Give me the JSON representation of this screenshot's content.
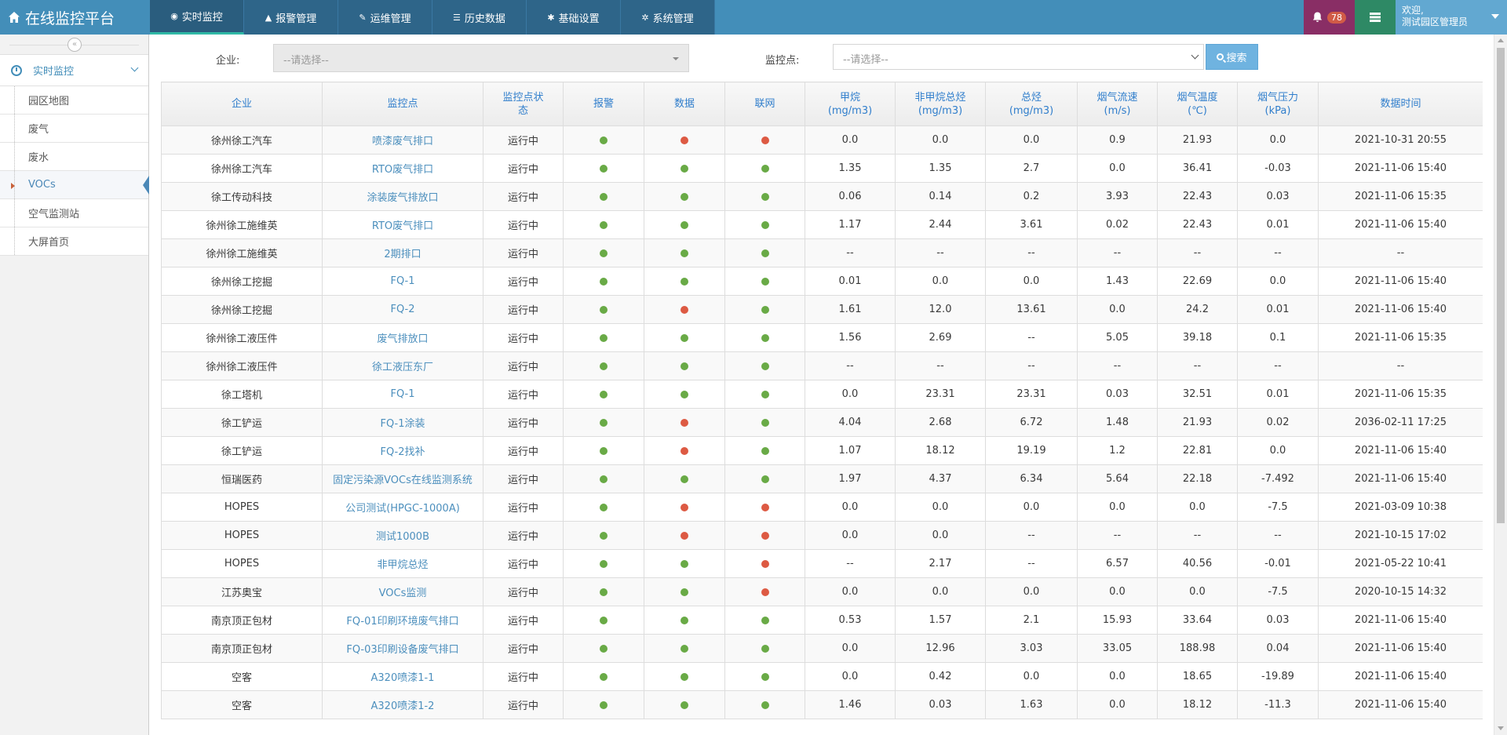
{
  "app": {
    "title": "在线监控平台"
  },
  "topnav": [
    {
      "label": "实时监控",
      "icon": "dashboard-icon",
      "active": true
    },
    {
      "label": "报警管理",
      "icon": "warning-icon",
      "active": false
    },
    {
      "label": "运维管理",
      "icon": "wrench-icon",
      "active": false
    },
    {
      "label": "历史数据",
      "icon": "database-icon",
      "active": false
    },
    {
      "label": "基础设置",
      "icon": "gear-icon",
      "active": false
    },
    {
      "label": "系统管理",
      "icon": "gears-icon",
      "active": false
    }
  ],
  "header": {
    "notification_count": "78",
    "welcome": "欢迎,",
    "username": "测试园区管理员"
  },
  "sidebar": {
    "parent": {
      "label": "实时监控",
      "icon": "clock-icon"
    },
    "items": [
      {
        "label": "园区地图",
        "active": false
      },
      {
        "label": "废气",
        "active": false
      },
      {
        "label": "废水",
        "active": false
      },
      {
        "label": "VOCs",
        "active": true
      },
      {
        "label": "空气监测站",
        "active": false
      },
      {
        "label": "大屏首页",
        "active": false
      }
    ]
  },
  "filters": {
    "company_label": "企业:",
    "company_placeholder": "--请选择--",
    "point_label": "监控点:",
    "point_placeholder": "--请选择--",
    "search_label": "搜索"
  },
  "colors": {
    "green": "#69aa46",
    "red": "#dd5a43",
    "accent": "#438eb9"
  },
  "table": {
    "headers": [
      [
        "企业"
      ],
      [
        "监控点"
      ],
      [
        "监控点状",
        "态"
      ],
      [
        "报警"
      ],
      [
        "数据"
      ],
      [
        "联网"
      ],
      [
        "甲烷",
        "(mg/m3)"
      ],
      [
        "非甲烷总烃",
        "(mg/m3)"
      ],
      [
        "总烃",
        "(mg/m3)"
      ],
      [
        "烟气流速",
        "(m/s)"
      ],
      [
        "烟气温度",
        "(℃)"
      ],
      [
        "烟气压力",
        "(kPa)"
      ],
      [
        "数据时间"
      ]
    ],
    "rows": [
      {
        "company": "徐州徐工汽车",
        "point": "喷漆废气排口",
        "status": "运行中",
        "alarm": "green",
        "data": "red",
        "net": "red",
        "ch4": "0.0",
        "nmhc": "0.0",
        "thc": "0.0",
        "flow": "0.9",
        "temp": "21.93",
        "pressure": "0.0",
        "time": "2021-10-31 20:55"
      },
      {
        "company": "徐州徐工汽车",
        "point": "RTO废气排口",
        "status": "运行中",
        "alarm": "green",
        "data": "green",
        "net": "green",
        "ch4": "1.35",
        "nmhc": "1.35",
        "thc": "2.7",
        "flow": "0.0",
        "temp": "36.41",
        "pressure": "-0.03",
        "time": "2021-11-06 15:40"
      },
      {
        "company": "徐工传动科技",
        "point": "涂装废气排放口",
        "status": "运行中",
        "alarm": "green",
        "data": "green",
        "net": "green",
        "ch4": "0.06",
        "nmhc": "0.14",
        "thc": "0.2",
        "flow": "3.93",
        "temp": "22.43",
        "pressure": "0.03",
        "time": "2021-11-06 15:35"
      },
      {
        "company": "徐州徐工施维英",
        "point": "RTO废气排口",
        "status": "运行中",
        "alarm": "green",
        "data": "green",
        "net": "green",
        "ch4": "1.17",
        "nmhc": "2.44",
        "thc": "3.61",
        "flow": "0.02",
        "temp": "22.43",
        "pressure": "0.01",
        "time": "2021-11-06 15:40"
      },
      {
        "company": "徐州徐工施维英",
        "point": "2期排口",
        "status": "运行中",
        "alarm": "green",
        "data": "green",
        "net": "green",
        "ch4": "--",
        "nmhc": "--",
        "thc": "--",
        "flow": "--",
        "temp": "--",
        "pressure": "--",
        "time": "--"
      },
      {
        "company": "徐州徐工挖掘",
        "point": "FQ-1",
        "status": "运行中",
        "alarm": "green",
        "data": "green",
        "net": "green",
        "ch4": "0.01",
        "nmhc": "0.0",
        "thc": "0.0",
        "flow": "1.43",
        "temp": "22.69",
        "pressure": "0.0",
        "time": "2021-11-06 15:40"
      },
      {
        "company": "徐州徐工挖掘",
        "point": "FQ-2",
        "status": "运行中",
        "alarm": "green",
        "data": "red",
        "net": "green",
        "ch4": "1.61",
        "nmhc": "12.0",
        "thc": "13.61",
        "flow": "0.0",
        "temp": "24.2",
        "pressure": "0.01",
        "time": "2021-11-06 15:40"
      },
      {
        "company": "徐州徐工液压件",
        "point": "废气排放口",
        "status": "运行中",
        "alarm": "green",
        "data": "green",
        "net": "green",
        "ch4": "1.56",
        "nmhc": "2.69",
        "thc": "--",
        "flow": "5.05",
        "temp": "39.18",
        "pressure": "0.1",
        "time": "2021-11-06 15:35"
      },
      {
        "company": "徐州徐工液压件",
        "point": "徐工液压东厂",
        "status": "运行中",
        "alarm": "green",
        "data": "green",
        "net": "green",
        "ch4": "--",
        "nmhc": "--",
        "thc": "--",
        "flow": "--",
        "temp": "--",
        "pressure": "--",
        "time": "--"
      },
      {
        "company": "徐工塔机",
        "point": "FQ-1",
        "status": "运行中",
        "alarm": "green",
        "data": "green",
        "net": "green",
        "ch4": "0.0",
        "nmhc": "23.31",
        "thc": "23.31",
        "flow": "0.03",
        "temp": "32.51",
        "pressure": "0.01",
        "time": "2021-11-06 15:35"
      },
      {
        "company": "徐工铲运",
        "point": "FQ-1涂装",
        "status": "运行中",
        "alarm": "green",
        "data": "red",
        "net": "green",
        "ch4": "4.04",
        "nmhc": "2.68",
        "thc": "6.72",
        "flow": "1.48",
        "temp": "21.93",
        "pressure": "0.02",
        "time": "2036-02-11 17:25"
      },
      {
        "company": "徐工铲运",
        "point": "FQ-2找补",
        "status": "运行中",
        "alarm": "green",
        "data": "red",
        "net": "green",
        "ch4": "1.07",
        "nmhc": "18.12",
        "thc": "19.19",
        "flow": "1.2",
        "temp": "22.81",
        "pressure": "0.0",
        "time": "2021-11-06 15:40"
      },
      {
        "company": "恒瑞医药",
        "point": "固定污染源VOCs在线监测系统",
        "status": "运行中",
        "alarm": "green",
        "data": "green",
        "net": "green",
        "ch4": "1.97",
        "nmhc": "4.37",
        "thc": "6.34",
        "flow": "5.64",
        "temp": "22.18",
        "pressure": "-7.492",
        "time": "2021-11-06 15:40"
      },
      {
        "company": "HOPES",
        "point": "公司测试(HPGC-1000A)",
        "status": "运行中",
        "alarm": "green",
        "data": "red",
        "net": "red",
        "ch4": "0.0",
        "nmhc": "0.0",
        "thc": "0.0",
        "flow": "0.0",
        "temp": "0.0",
        "pressure": "-7.5",
        "time": "2021-03-09 10:38"
      },
      {
        "company": "HOPES",
        "point": "测试1000B",
        "status": "运行中",
        "alarm": "green",
        "data": "red",
        "net": "red",
        "ch4": "0.0",
        "nmhc": "0.0",
        "thc": "--",
        "flow": "--",
        "temp": "--",
        "pressure": "--",
        "time": "2021-10-15 17:02"
      },
      {
        "company": "HOPES",
        "point": "非甲烷总烃",
        "status": "运行中",
        "alarm": "green",
        "data": "green",
        "net": "red",
        "ch4": "--",
        "nmhc": "2.17",
        "thc": "--",
        "flow": "6.57",
        "temp": "40.56",
        "pressure": "-0.01",
        "time": "2021-05-22 10:41"
      },
      {
        "company": "江苏奥宝",
        "point": "VOCs监测",
        "status": "运行中",
        "alarm": "green",
        "data": "green",
        "net": "red",
        "ch4": "0.0",
        "nmhc": "0.0",
        "thc": "0.0",
        "flow": "0.0",
        "temp": "0.0",
        "pressure": "-7.5",
        "time": "2020-10-15 14:32"
      },
      {
        "company": "南京顶正包材",
        "point": "FQ-01印刷环境废气排口",
        "status": "运行中",
        "alarm": "green",
        "data": "green",
        "net": "green",
        "ch4": "0.53",
        "nmhc": "1.57",
        "thc": "2.1",
        "flow": "15.93",
        "temp": "33.64",
        "pressure": "0.03",
        "time": "2021-11-06 15:40"
      },
      {
        "company": "南京顶正包材",
        "point": "FQ-03印刷设备废气排口",
        "status": "运行中",
        "alarm": "green",
        "data": "green",
        "net": "green",
        "ch4": "0.0",
        "nmhc": "12.96",
        "thc": "3.03",
        "flow": "33.05",
        "temp": "188.98",
        "pressure": "0.04",
        "time": "2021-11-06 15:40"
      },
      {
        "company": "空客",
        "point": "A320喷漆1-1",
        "status": "运行中",
        "alarm": "green",
        "data": "green",
        "net": "green",
        "ch4": "0.0",
        "nmhc": "0.42",
        "thc": "0.0",
        "flow": "0.0",
        "temp": "18.65",
        "pressure": "-19.89",
        "time": "2021-11-06 15:40"
      },
      {
        "company": "空客",
        "point": "A320喷漆1-2",
        "status": "运行中",
        "alarm": "green",
        "data": "green",
        "net": "green",
        "ch4": "1.46",
        "nmhc": "0.03",
        "thc": "1.63",
        "flow": "0.0",
        "temp": "18.12",
        "pressure": "-11.3",
        "time": "2021-11-06 15:40"
      }
    ]
  }
}
